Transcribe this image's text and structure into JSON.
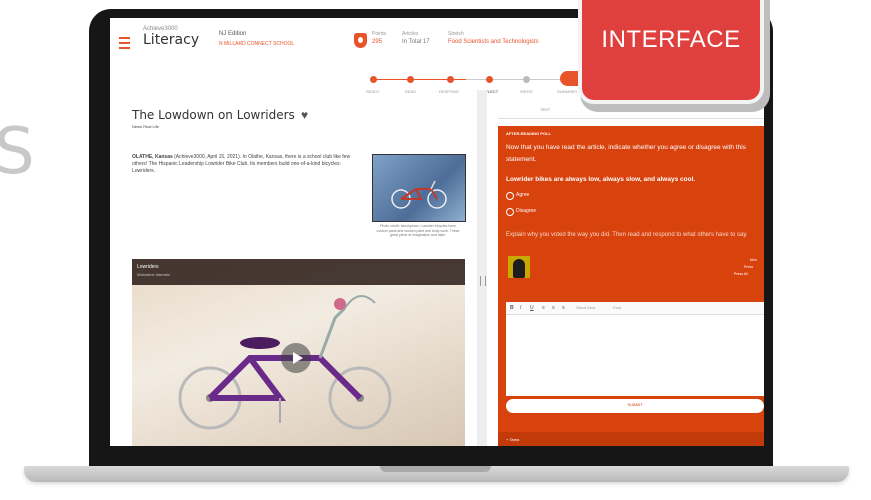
{
  "left_letter": "S",
  "badge": {
    "text": "INTERFACE"
  },
  "header": {
    "brand_small": "Achieve3000",
    "brand": "Literacy",
    "edition": "NJ Edition",
    "school": "N MILLARD CONNECT SCHOOL",
    "stats": [
      {
        "label": "Points",
        "value": "295"
      },
      {
        "label": "Articles",
        "value": "In Total 17"
      },
      {
        "label": "Stretch",
        "value": "Food Scientists and Technologists"
      }
    ]
  },
  "steps": [
    "READY",
    "READ",
    "RESPOND",
    "REFLECT",
    "WRITE",
    "SUMMARY"
  ],
  "article": {
    "title": "The Lowdown on Lowriders",
    "subtitle": "News Real Life",
    "dateline": "OLATHE, Kansas",
    "body": " (Achieve3000, April 15, 2021). In Olathe, Kansas, there is a school club like few others! The Hispanic Leadership Lowrider Bike Club. Its members build one-of-a-kind bicycles: Lowriders.",
    "caption": "Photo credit: Istockphoto. Lowrider bicycles have custom parts and custom paint and body work. These great piece of imagination and style."
  },
  "video": {
    "title": "Lowriders",
    "subtitle": "Wolverine Intermix"
  },
  "panel": {
    "tab": "TEXT",
    "poll_label": "AFTER-READING POLL",
    "poll_text": "Now that you have read the article, indicate whether you agree or disagree with this statement.",
    "statement": "Lowrider bikes are always low, always slow, and always cool.",
    "options": [
      "Agree",
      "Disagree"
    ],
    "explain": "Explain why you voted the way you did. Then read and respond to what others have to say.",
    "side_info": [
      "Mon",
      "Press",
      "Press All"
    ],
    "toolbar": [
      "B",
      "I",
      "U",
      "≡",
      "≡",
      "≡",
      "Sized Sent",
      "Font"
    ],
    "submit": "SUBMIT",
    "below": "+ Tarea"
  }
}
